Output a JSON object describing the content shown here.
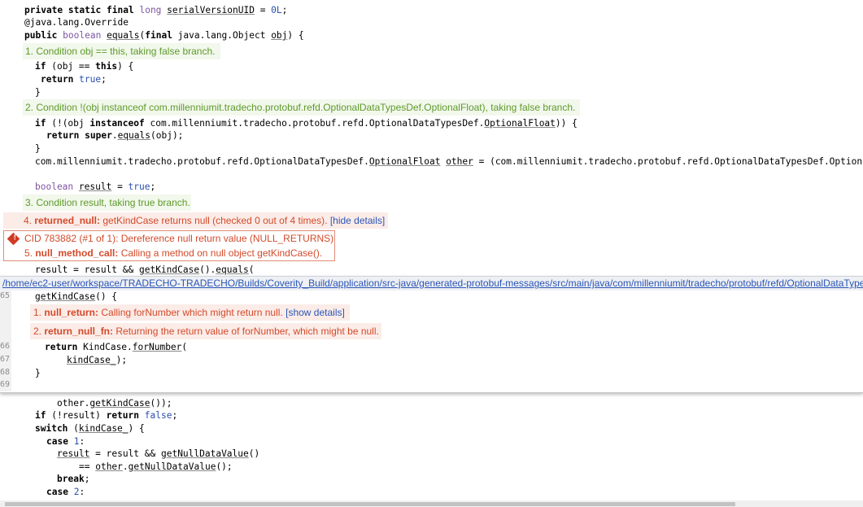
{
  "code_top": {
    "l1": {
      "kw": "private static final",
      "ty": "long",
      "name": "serialVersionUID",
      "eq": " = ",
      "val": "0L",
      "end": ";"
    },
    "l2": "@java.lang.Override",
    "l3": {
      "kw": "public",
      "ty": "boolean",
      "name": "equals",
      "rest": "(",
      "kw2": "final",
      "rest2": " java.lang.Object ",
      "arg": "obj",
      "end": ") {"
    },
    "l4": {
      "kw": "if",
      "rest": " (obj == ",
      "kw2": "this",
      "end": ") {"
    },
    "l5": {
      "kw": "return",
      "val": "true",
      "end": ";"
    },
    "l6": "}",
    "l7": {
      "kw": "if",
      "rest": " (!(obj ",
      "kw2": "instanceof",
      "rest2": " com.millenniumit.tradecho.protobuf.refd.OptionalDataTypesDef.",
      "cls": "OptionalFloat",
      "end": ")) {"
    },
    "l8": {
      "kw": "return super",
      "rest": ".",
      "name": "equals",
      "end": "(obj);"
    },
    "l9": "}",
    "l10": {
      "pre": "com.millenniumit.tradecho.protobuf.refd.OptionalDataTypesDef.",
      "cls": "OptionalFloat",
      "var": "other",
      "rest": " = (com.millenniumit.tradecho.protobuf.refd.OptionalDataTypesDef.OptionalF"
    },
    "l11": {
      "ty": "boolean",
      "name": "result",
      "eq": " = ",
      "val": "true",
      "end": ";"
    },
    "l12": {
      "pre": "result = result && ",
      "name": "getKindCase",
      "rest": "().",
      "name2": "equals",
      "end": "("
    }
  },
  "events": {
    "e1": "1. Condition obj == this, taking false branch.",
    "e2": "2. Condition !(obj instanceof com.millenniumit.tradecho.protobuf.refd.OptionalDataTypesDef.OptionalFloat), taking false branch.",
    "e3": "3. Condition result, taking true branch.",
    "e4_num": "4. ",
    "e4_tag": "returned_null:",
    "e4_text": " getKindCase returns null (checked 0 out of 4 times). ",
    "e4_link": "[hide details]",
    "cid": "CID 783882 (#1 of 1): Dereference null return value (NULL_RETURNS)",
    "e5_num": "5. ",
    "e5_tag": "null_method_call:",
    "e5_text": " Calling a method on null object getKindCase()."
  },
  "popup": {
    "path": "/home/ec2-user/workspace/TRADECHO-TRADECHO/Builds/Coverity_Build/application/src-java/generated-protobuf-messages/src/main/java/com/millenniumit/tradecho/protobuf/refd/OptionalDataType",
    "ln65": "65",
    "ln66": "66",
    "ln67": "67",
    "ln68": "68",
    "ln69": "69",
    "c65_name": "getKindCase",
    "c65_rest": "() {",
    "n1_num": "1. ",
    "n1_tag": "null_return:",
    "n1_text": " Calling forNumber which might return null. ",
    "n1_link": "[show details]",
    "n2_num": "2. ",
    "n2_tag": "return_null_fn:",
    "n2_text": " Returning the return value of forNumber, which might be null.",
    "c66_kw": "return",
    "c66_rest": " KindCase.",
    "c66_name": "forNumber",
    "c66_end": "(",
    "c67_name": "kindCase_",
    "c67_end": ");",
    "c68": "}"
  },
  "code_bottom": {
    "b1": {
      "pre": "other.",
      "name": "getKindCase",
      "end": "());"
    },
    "b2": {
      "kw": "if",
      "rest": " (!result) ",
      "kw2": "return",
      "val": "false",
      "end": ";"
    },
    "b3": {
      "kw": "switch",
      "rest": " (",
      "name": "kindCase_",
      "end": ") {"
    },
    "b4": {
      "kw": "case",
      "val": "1",
      "end": ":"
    },
    "b5": {
      "name": "result",
      "rest": " = result && ",
      "name2": "getNullDataValue",
      "end": "()"
    },
    "b6": {
      "rest": "== ",
      "name": "other",
      "rest2": ".",
      "name2": "getNullDataValue",
      "end": "();"
    },
    "b7": {
      "kw": "break",
      "end": ";"
    },
    "b8": {
      "kw": "case",
      "val": "2",
      "end": ":"
    }
  },
  "colors": {
    "green_note": "#5e9a2c",
    "red_note": "#d34a2a",
    "link": "#2a55b8",
    "keyword_type": "#7f55a1",
    "literal": "#2a4fb0"
  }
}
